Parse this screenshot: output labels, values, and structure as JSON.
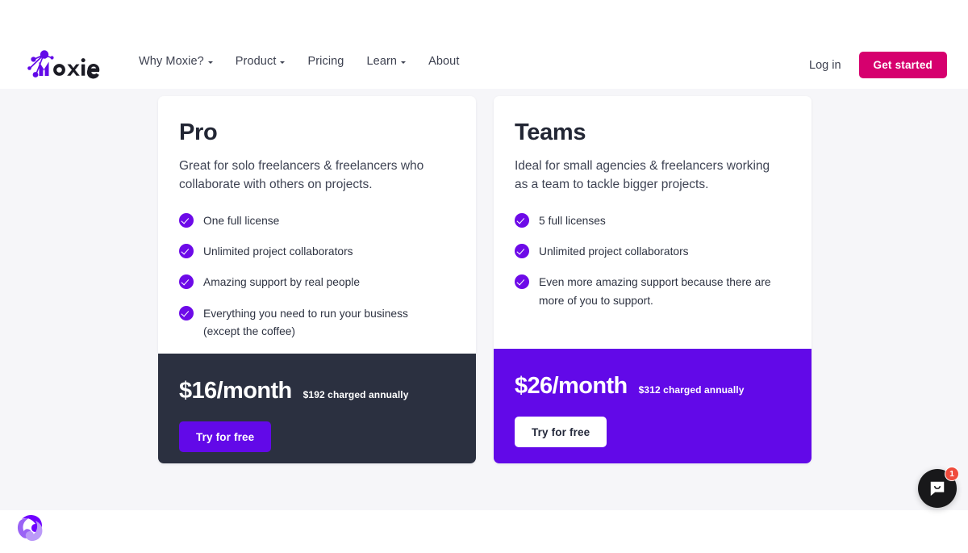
{
  "header": {
    "logo_text": "Moxie",
    "nav": [
      {
        "label": "Why Moxie?",
        "has_dropdown": true
      },
      {
        "label": "Product",
        "has_dropdown": true
      },
      {
        "label": "Pricing",
        "has_dropdown": false
      },
      {
        "label": "Learn",
        "has_dropdown": true
      },
      {
        "label": "About",
        "has_dropdown": false
      }
    ],
    "login_label": "Log in",
    "get_started_label": "Get started",
    "accent_pink": "#d6006e"
  },
  "plans": [
    {
      "title": "Pro",
      "description": "Great for solo freelancers & freelancers who collaborate with others on projects.",
      "features": [
        "One full license",
        "Unlimited project collaborators",
        "Amazing support by real people",
        "Everything you need to run your business (except the coffee)"
      ],
      "price": "$16/month",
      "price_note": "$192 charged annually",
      "cta_label": "Try for free",
      "footer_bg": "#2b3040",
      "cta_bg": "#6209e8"
    },
    {
      "title": "Teams",
      "description": "Ideal for small agencies & freelancers working as a team to tackle bigger projects.",
      "features": [
        "5 full licenses",
        "Unlimited project collaborators",
        "Even more amazing support because there are more of you to support."
      ],
      "price": "$26/month",
      "price_note": "$312 charged annually",
      "cta_label": "Try for free",
      "footer_bg": "#6209e8",
      "cta_bg": "#ffffff"
    }
  ],
  "chat": {
    "badge_count": "1",
    "badge_color": "#ef4b3c",
    "button_color": "#18181a"
  },
  "theme": {
    "page_bg": "#f6f6f9",
    "card_bg": "#ffffff",
    "purple": "#6209e8",
    "check_purple": "#6d0ae8",
    "heading": "#222634"
  }
}
